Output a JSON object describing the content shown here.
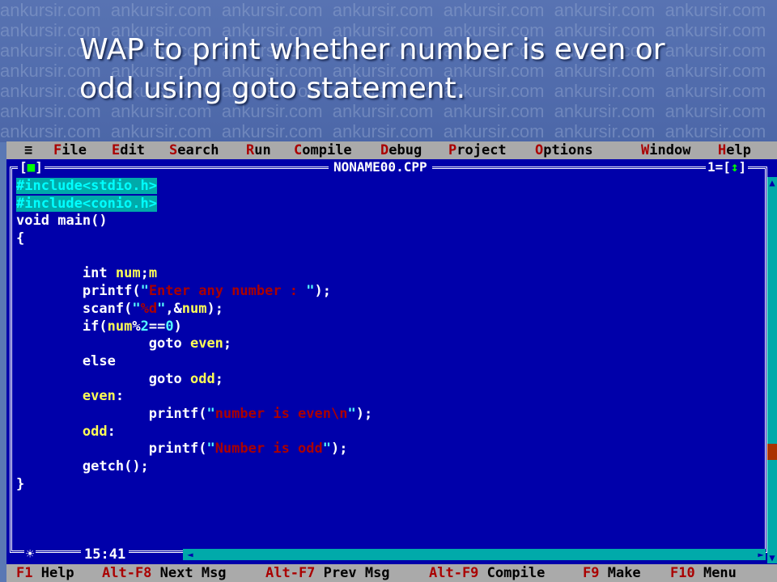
{
  "slide": {
    "title_line1": "WAP to print whether number is even or",
    "title_line2": "odd using goto statement.",
    "watermark": "ankursir.com"
  },
  "menubar": {
    "system_icon": "≡",
    "items": [
      "File",
      "Edit",
      "Search",
      "Run",
      "Compile",
      "Debug",
      "Project",
      "Options",
      "Window",
      "Help"
    ]
  },
  "editor": {
    "close_button": "[■]",
    "filename": "NONAME00.CPP",
    "window_number": "1=[↕]",
    "cursor_position": "15:41",
    "modified_indicator": "☀",
    "code_lines": [
      "#include<stdio.h>",
      "#include<conio.h>",
      "void main()",
      "{",
      "",
      "        int num;m",
      "        printf(\"Enter any number : \");",
      "        scanf(\"%d\",&num);",
      "        if(num%2==0)",
      "                goto even;",
      "        else",
      "                goto odd;",
      "        even:",
      "                printf(\"number is even\\n\");",
      "        odd:",
      "                printf(\"Number is odd\");",
      "        getch();",
      "}"
    ]
  },
  "statusbar": {
    "items": [
      {
        "key": "F1",
        "label": "Help"
      },
      {
        "key": "Alt-F8",
        "label": "Next Msg"
      },
      {
        "key": "Alt-F7",
        "label": "Prev Msg"
      },
      {
        "key": "Alt-F9",
        "label": "Compile"
      },
      {
        "key": "F9",
        "label": "Make"
      },
      {
        "key": "F10",
        "label": "Menu"
      }
    ]
  },
  "colors": {
    "editor_bg": "#0000aa",
    "menu_bg": "#aaaaaa",
    "hotkey": "#aa0000",
    "scroll": "#00aaaa",
    "string": "#aa0000",
    "identifier": "#ffff55"
  }
}
